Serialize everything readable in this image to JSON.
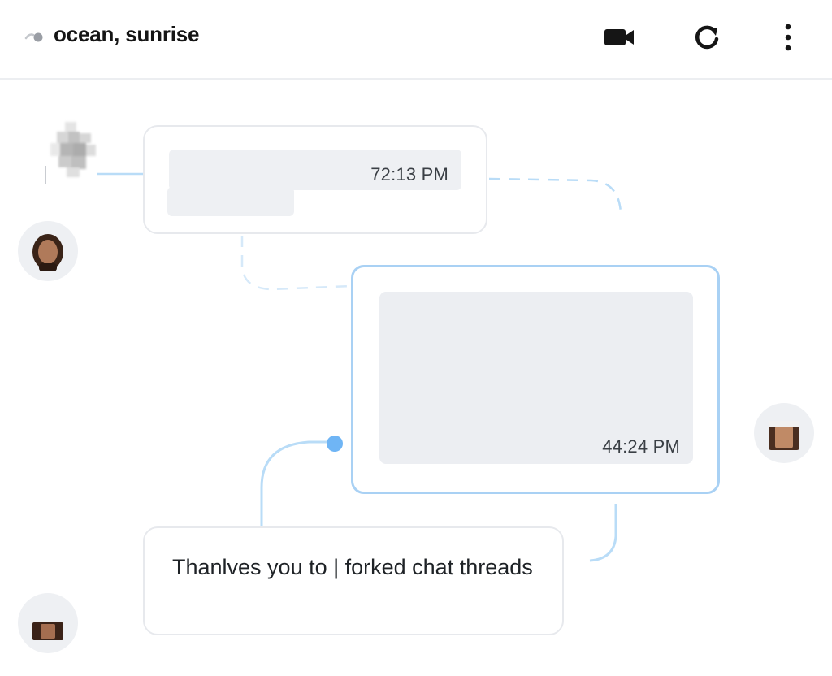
{
  "header": {
    "title": "ocean, sunrise",
    "icons": {
      "back": "back-icon",
      "video": "video-camera-icon",
      "refresh": "refresh-icon",
      "more": "more-vertical-icon"
    }
  },
  "messages": [
    {
      "time": "72:13 PM",
      "content": "",
      "redacted": true
    },
    {
      "time": "44:24 PM",
      "content": "",
      "redacted": true,
      "selected": true
    },
    {
      "time": "",
      "content": "Thanlves you to | forked chat threads"
    }
  ],
  "colors": {
    "accent": "#a9d1f4",
    "connector": "#b9dcf7",
    "branch_dot": "#6fb5f5",
    "skeleton": "#eef0f3"
  }
}
